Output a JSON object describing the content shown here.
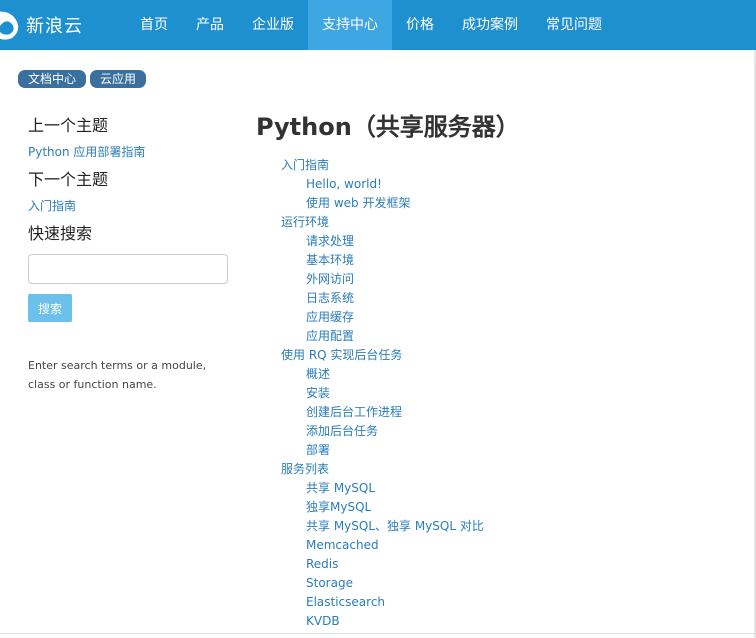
{
  "header": {
    "logo_text": "新浪云",
    "nav": [
      {
        "label": "首页"
      },
      {
        "label": "产品"
      },
      {
        "label": "企业版"
      },
      {
        "label": "支持中心"
      },
      {
        "label": "价格"
      },
      {
        "label": "成功案例"
      },
      {
        "label": "常见问题"
      }
    ],
    "active_index": 3
  },
  "breadcrumb": [
    "文档中心",
    "云应用"
  ],
  "sidebar": {
    "prev_heading": "上一个主题",
    "prev_link": "Python 应用部署指南",
    "next_heading": "下一个主题",
    "next_link": "入门指南",
    "search_heading": "快速搜索",
    "search_value": "",
    "search_button": "搜索",
    "search_hint": "Enter search terms or a module, class or function name."
  },
  "main": {
    "title": "Python（共享服务器）",
    "toc": [
      {
        "level": 1,
        "label": "入门指南"
      },
      {
        "level": 2,
        "label": "Hello, world!"
      },
      {
        "level": 2,
        "label": "使用 web 开发框架"
      },
      {
        "level": 1,
        "label": "运行环境"
      },
      {
        "level": 2,
        "label": "请求处理"
      },
      {
        "level": 2,
        "label": "基本环境"
      },
      {
        "level": 2,
        "label": "外网访问"
      },
      {
        "level": 2,
        "label": "日志系统"
      },
      {
        "level": 2,
        "label": "应用缓存"
      },
      {
        "level": 2,
        "label": "应用配置"
      },
      {
        "level": 1,
        "label": "使用 RQ 实现后台任务"
      },
      {
        "level": 2,
        "label": "概述"
      },
      {
        "level": 2,
        "label": "安装"
      },
      {
        "level": 2,
        "label": "创建后台工作进程"
      },
      {
        "level": 2,
        "label": "添加后台任务"
      },
      {
        "level": 2,
        "label": "部署"
      },
      {
        "level": 1,
        "label": "服务列表"
      },
      {
        "level": 2,
        "label": "共享 MySQL"
      },
      {
        "level": 2,
        "label": "独享MySQL"
      },
      {
        "level": 2,
        "label": "共享 MySQL、独享 MySQL 对比"
      },
      {
        "level": 2,
        "label": "Memcached"
      },
      {
        "level": 2,
        "label": "Redis"
      },
      {
        "level": 2,
        "label": "Storage"
      },
      {
        "level": 2,
        "label": "Elasticsearch"
      },
      {
        "level": 2,
        "label": "KVDB"
      }
    ]
  },
  "colors": {
    "header_bg": "#1f90cf",
    "nav_active_bg": "#3ea6e2",
    "link": "#2a7db8",
    "pill_bg": "#3a6f9e",
    "search_button_bg": "#6bc0ec"
  },
  "icons": {
    "logo": "sina-cloud-logo-icon"
  }
}
